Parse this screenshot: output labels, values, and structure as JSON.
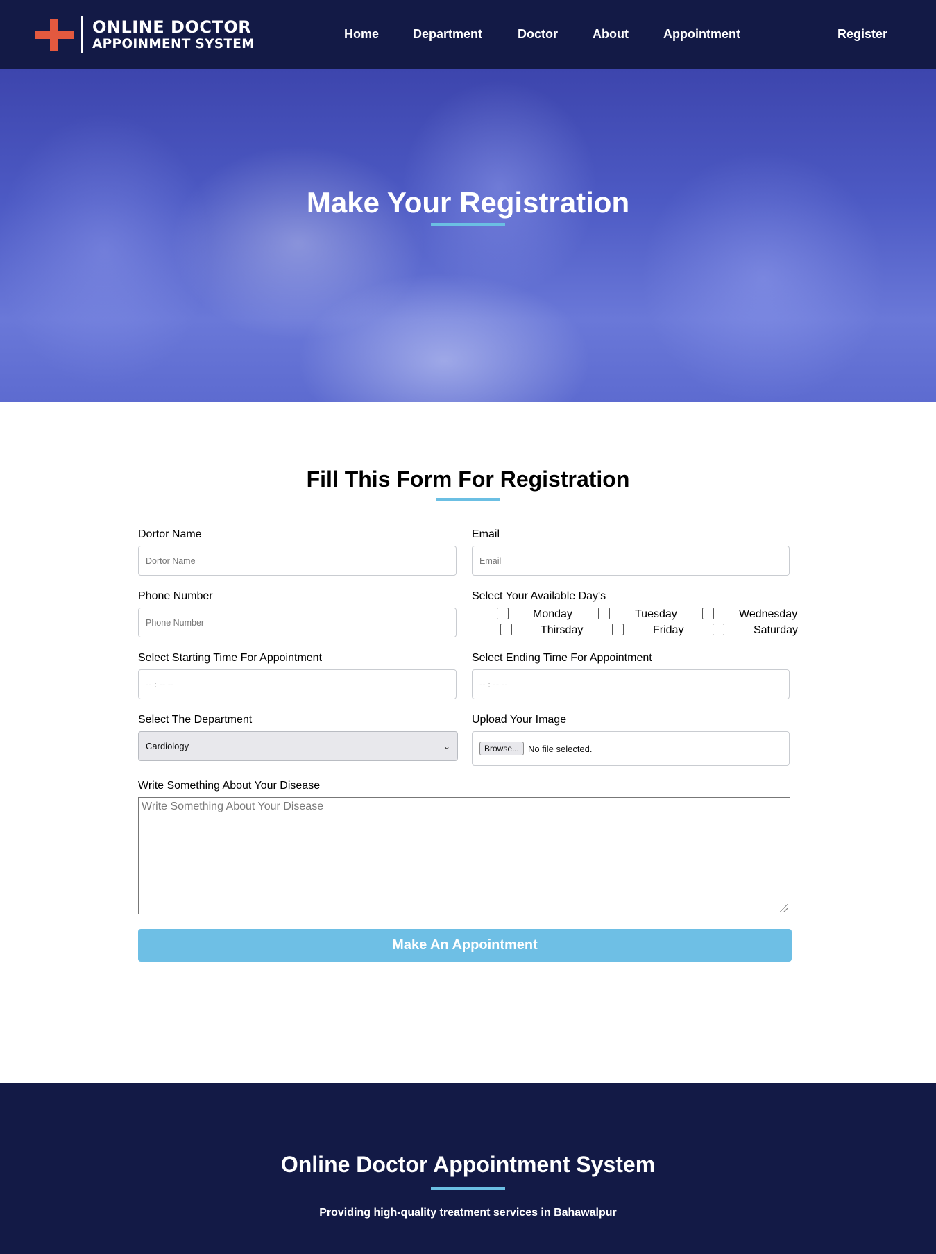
{
  "brand": {
    "line1": "ONLINE DOCTOR",
    "line2": "APPOINMENT SYSTEM",
    "cross_color": "#e3593f"
  },
  "nav": {
    "items": [
      {
        "label": "Home"
      },
      {
        "label": "Department"
      },
      {
        "label": "Doctor"
      },
      {
        "label": "About"
      },
      {
        "label": "Appointment"
      }
    ],
    "register": "Register"
  },
  "hero": {
    "title": "Make Your Registration"
  },
  "form": {
    "title": "Fill This Form For Registration",
    "doctor_name": {
      "label": "Dortor Name",
      "placeholder": "Dortor Name"
    },
    "email": {
      "label": "Email",
      "placeholder": "Email"
    },
    "phone": {
      "label": "Phone Number",
      "placeholder": "Phone Number"
    },
    "days": {
      "label": "Select Your Available Day's",
      "options": [
        {
          "label": "Monday",
          "checked": false
        },
        {
          "label": "Tuesday",
          "checked": false
        },
        {
          "label": "Wednesday",
          "checked": false
        },
        {
          "label": "Thirsday",
          "checked": false
        },
        {
          "label": "Friday",
          "checked": false
        },
        {
          "label": "Saturday",
          "checked": false
        }
      ]
    },
    "start_time": {
      "label": "Select Starting Time For Appointment",
      "value": "-- : --   --"
    },
    "end_time": {
      "label": "Select Ending Time For Appointment",
      "value": "-- : --   --"
    },
    "department": {
      "label": "Select The Department",
      "selected": "Cardiology"
    },
    "image": {
      "label": "Upload Your Image",
      "button": "Browse...",
      "status": "No file selected."
    },
    "disease": {
      "label": "Write Something About Your Disease",
      "placeholder": "Write Something About Your Disease"
    },
    "submit": "Make An Appointment"
  },
  "footer": {
    "title": "Online Doctor Appointment System",
    "tagline": "Providing high-quality treatment services in Bahawalpur"
  },
  "colors": {
    "navy": "#131a46",
    "accent_blue": "#6bbfe3",
    "button_blue": "#6ebfe5"
  },
  "icons": [
    "plus-cross-logo-icon",
    "chevron-down-icon",
    "resize-handle-icon"
  ]
}
